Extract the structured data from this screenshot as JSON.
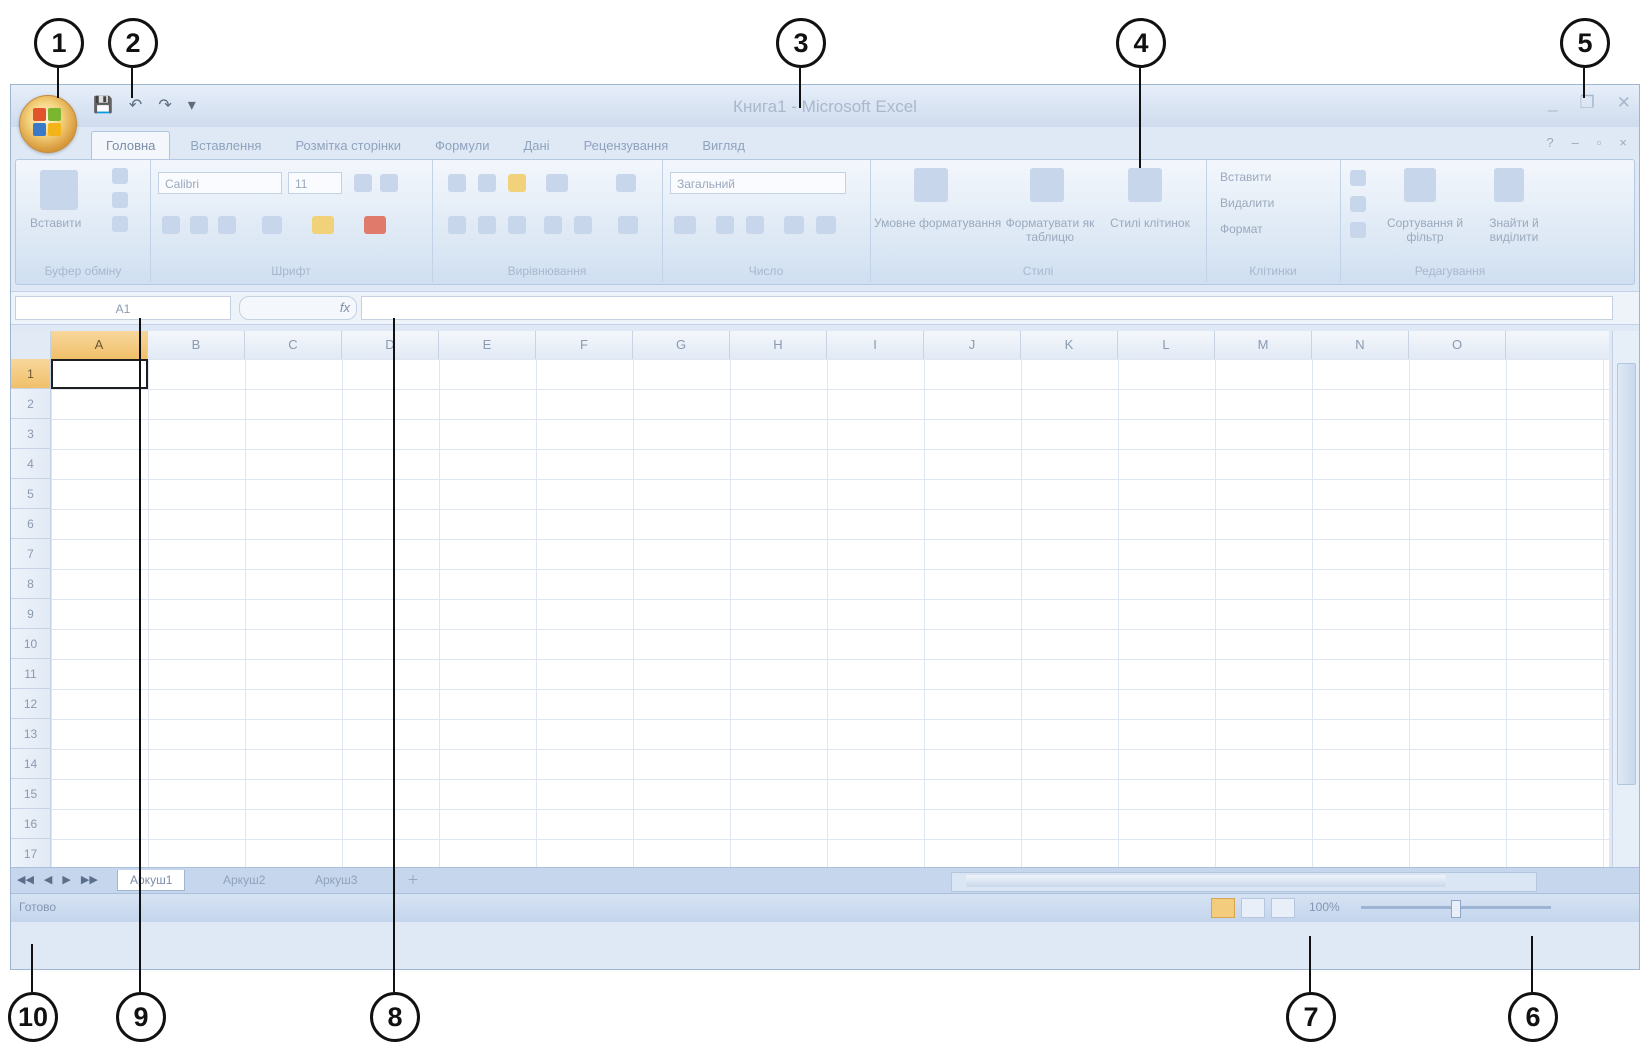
{
  "window": {
    "title": "Книга1 - Microsoft Excel",
    "controls": [
      "_",
      "❐",
      "✕"
    ]
  },
  "quick_access": [
    "save-icon",
    "undo-icon",
    "redo-icon",
    "customize-icon"
  ],
  "tabs": [
    {
      "label": "Головна",
      "active": true
    },
    {
      "label": "Вставлення"
    },
    {
      "label": "Розмітка сторінки"
    },
    {
      "label": "Формули"
    },
    {
      "label": "Дані"
    },
    {
      "label": "Рецензування"
    },
    {
      "label": "Вигляд"
    }
  ],
  "ribbon": {
    "clipboard": {
      "paste_label": "Вставити",
      "group_label": "Буфер обміну"
    },
    "font": {
      "font_name": "Calibri",
      "font_size": "11",
      "group_label": "Шрифт"
    },
    "alignment": {
      "group_label": "Вирівнювання"
    },
    "number": {
      "format": "Загальний",
      "group_label": "Число"
    },
    "styles": {
      "conditional": "Умовне форматування",
      "format_table": "Форматувати як таблицю",
      "cell_styles": "Стилі клітинок",
      "group_label": "Стилі"
    },
    "cells": {
      "insert": "Вставити",
      "delete": "Видалити",
      "format": "Формат",
      "group_label": "Клітинки"
    },
    "editing": {
      "sort": "Сортування й фільтр",
      "find": "Знайти й виділити",
      "group_label": "Редагування"
    }
  },
  "formula_bar": {
    "name_box": "A1",
    "fx_label": "fx",
    "value": ""
  },
  "columns": [
    "A",
    "B",
    "C",
    "D",
    "E",
    "F",
    "G",
    "H",
    "I",
    "J",
    "K",
    "L",
    "M",
    "N",
    "O"
  ],
  "rows": [
    "1",
    "2",
    "3",
    "4",
    "5",
    "6",
    "7",
    "8",
    "9",
    "10",
    "11",
    "12",
    "13",
    "14",
    "15",
    "16",
    "17"
  ],
  "sheets": [
    "Аркуш1",
    "Аркуш2",
    "Аркуш3"
  ],
  "status": {
    "text": "Готово",
    "zoom": "100%"
  },
  "callouts": [
    "1",
    "2",
    "3",
    "4",
    "5",
    "6",
    "7",
    "8",
    "9",
    "10"
  ]
}
